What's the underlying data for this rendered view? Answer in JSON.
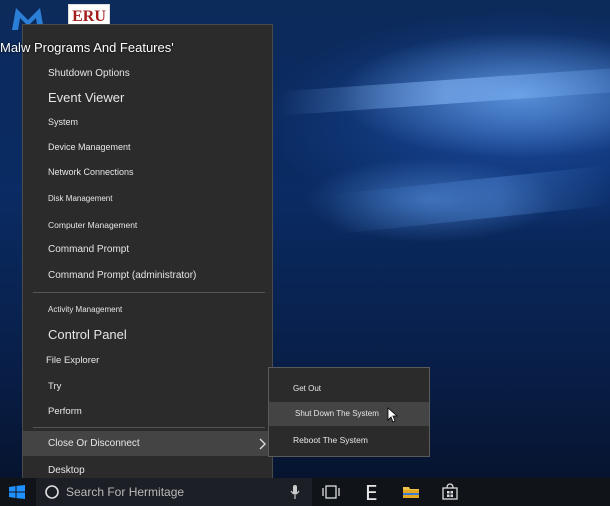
{
  "desktop": {
    "icon_text": "ERU"
  },
  "menu": {
    "title": "Malw Programs And Features'",
    "items": [
      "Shutdown Options",
      "Event Viewer",
      "System",
      "Device Management",
      "Network Connections",
      "Disk Management",
      "Computer Management",
      "Command Prompt",
      "Command Prompt (administrator)",
      "Activity Management",
      "Control Panel",
      "File Explorer",
      "Try",
      "Perform",
      "Close Or Disconnect",
      "Desktop"
    ]
  },
  "submenu": {
    "items": [
      "Get Out",
      "Shut Down The System",
      "Reboot The System"
    ]
  },
  "taskbar": {
    "search_placeholder": "Search For Hermitage",
    "task_letter": "E"
  },
  "colors": {
    "menu_bg": "#2b2b2b",
    "highlight": "#444444",
    "accent": "#1e90ff"
  }
}
